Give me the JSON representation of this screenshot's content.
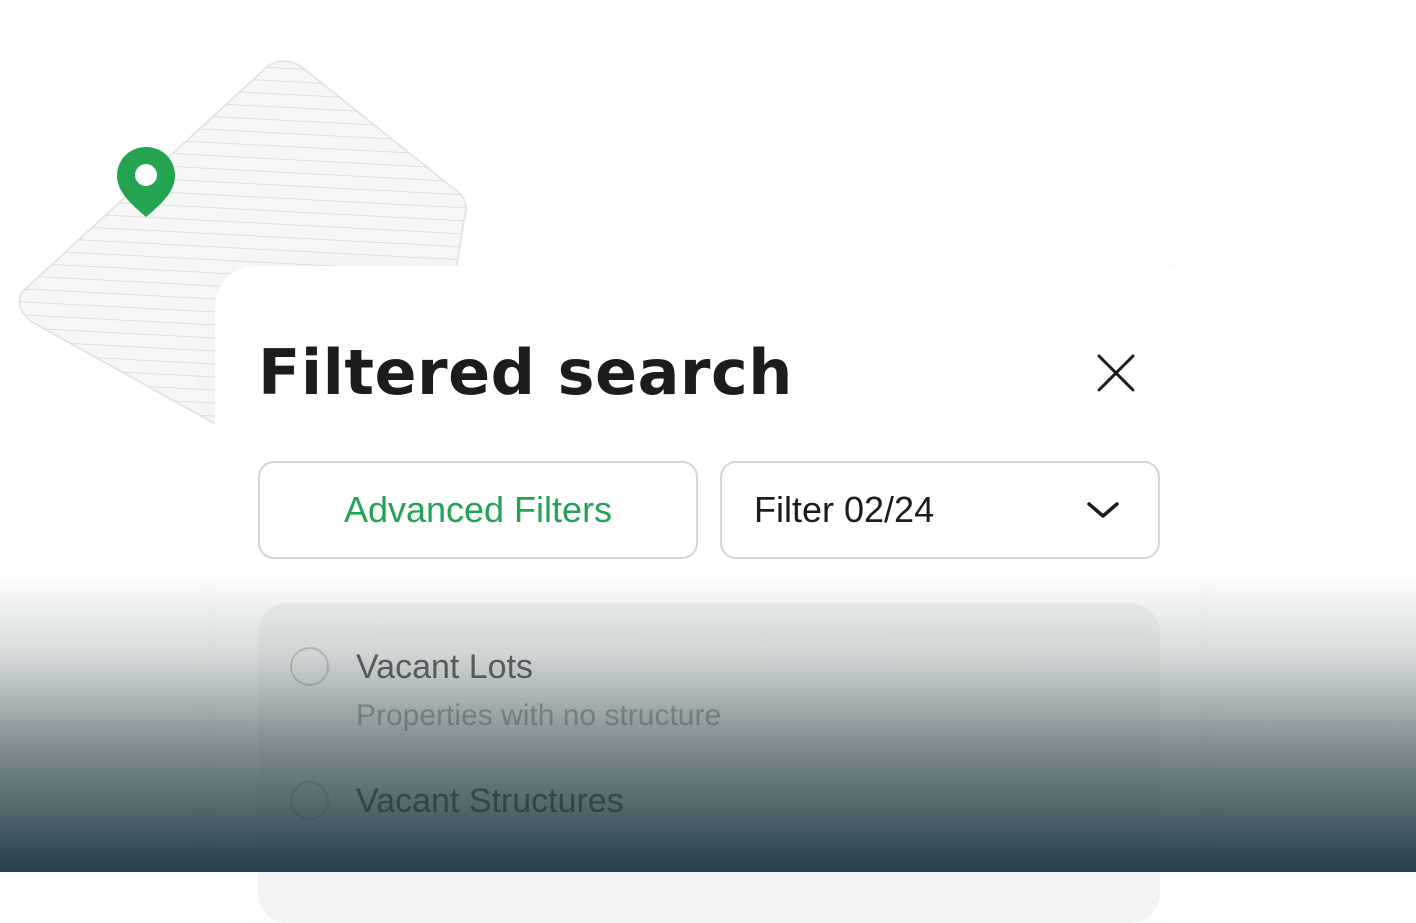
{
  "modal": {
    "title": "Filtered search",
    "close_icon": "close-icon",
    "advanced_filters_label": "Advanced Filters",
    "filter_select": {
      "selected_value": "Filter 02/24",
      "icon": "chevron-down-icon"
    },
    "options": [
      {
        "title": "Vacant Lots",
        "description": "Properties with no structure",
        "selected": false
      },
      {
        "title": "Vacant Structures",
        "selected": false
      }
    ]
  },
  "map": {
    "pin_icon": "location-pin-icon"
  },
  "colors": {
    "accent_green": "#23a455",
    "text_dark": "#1c1c1c",
    "text_muted": "#8a8f8e",
    "border": "#d4d6d5",
    "panel_bg": "#f2f3f3",
    "overlay_dark": "#203942"
  }
}
